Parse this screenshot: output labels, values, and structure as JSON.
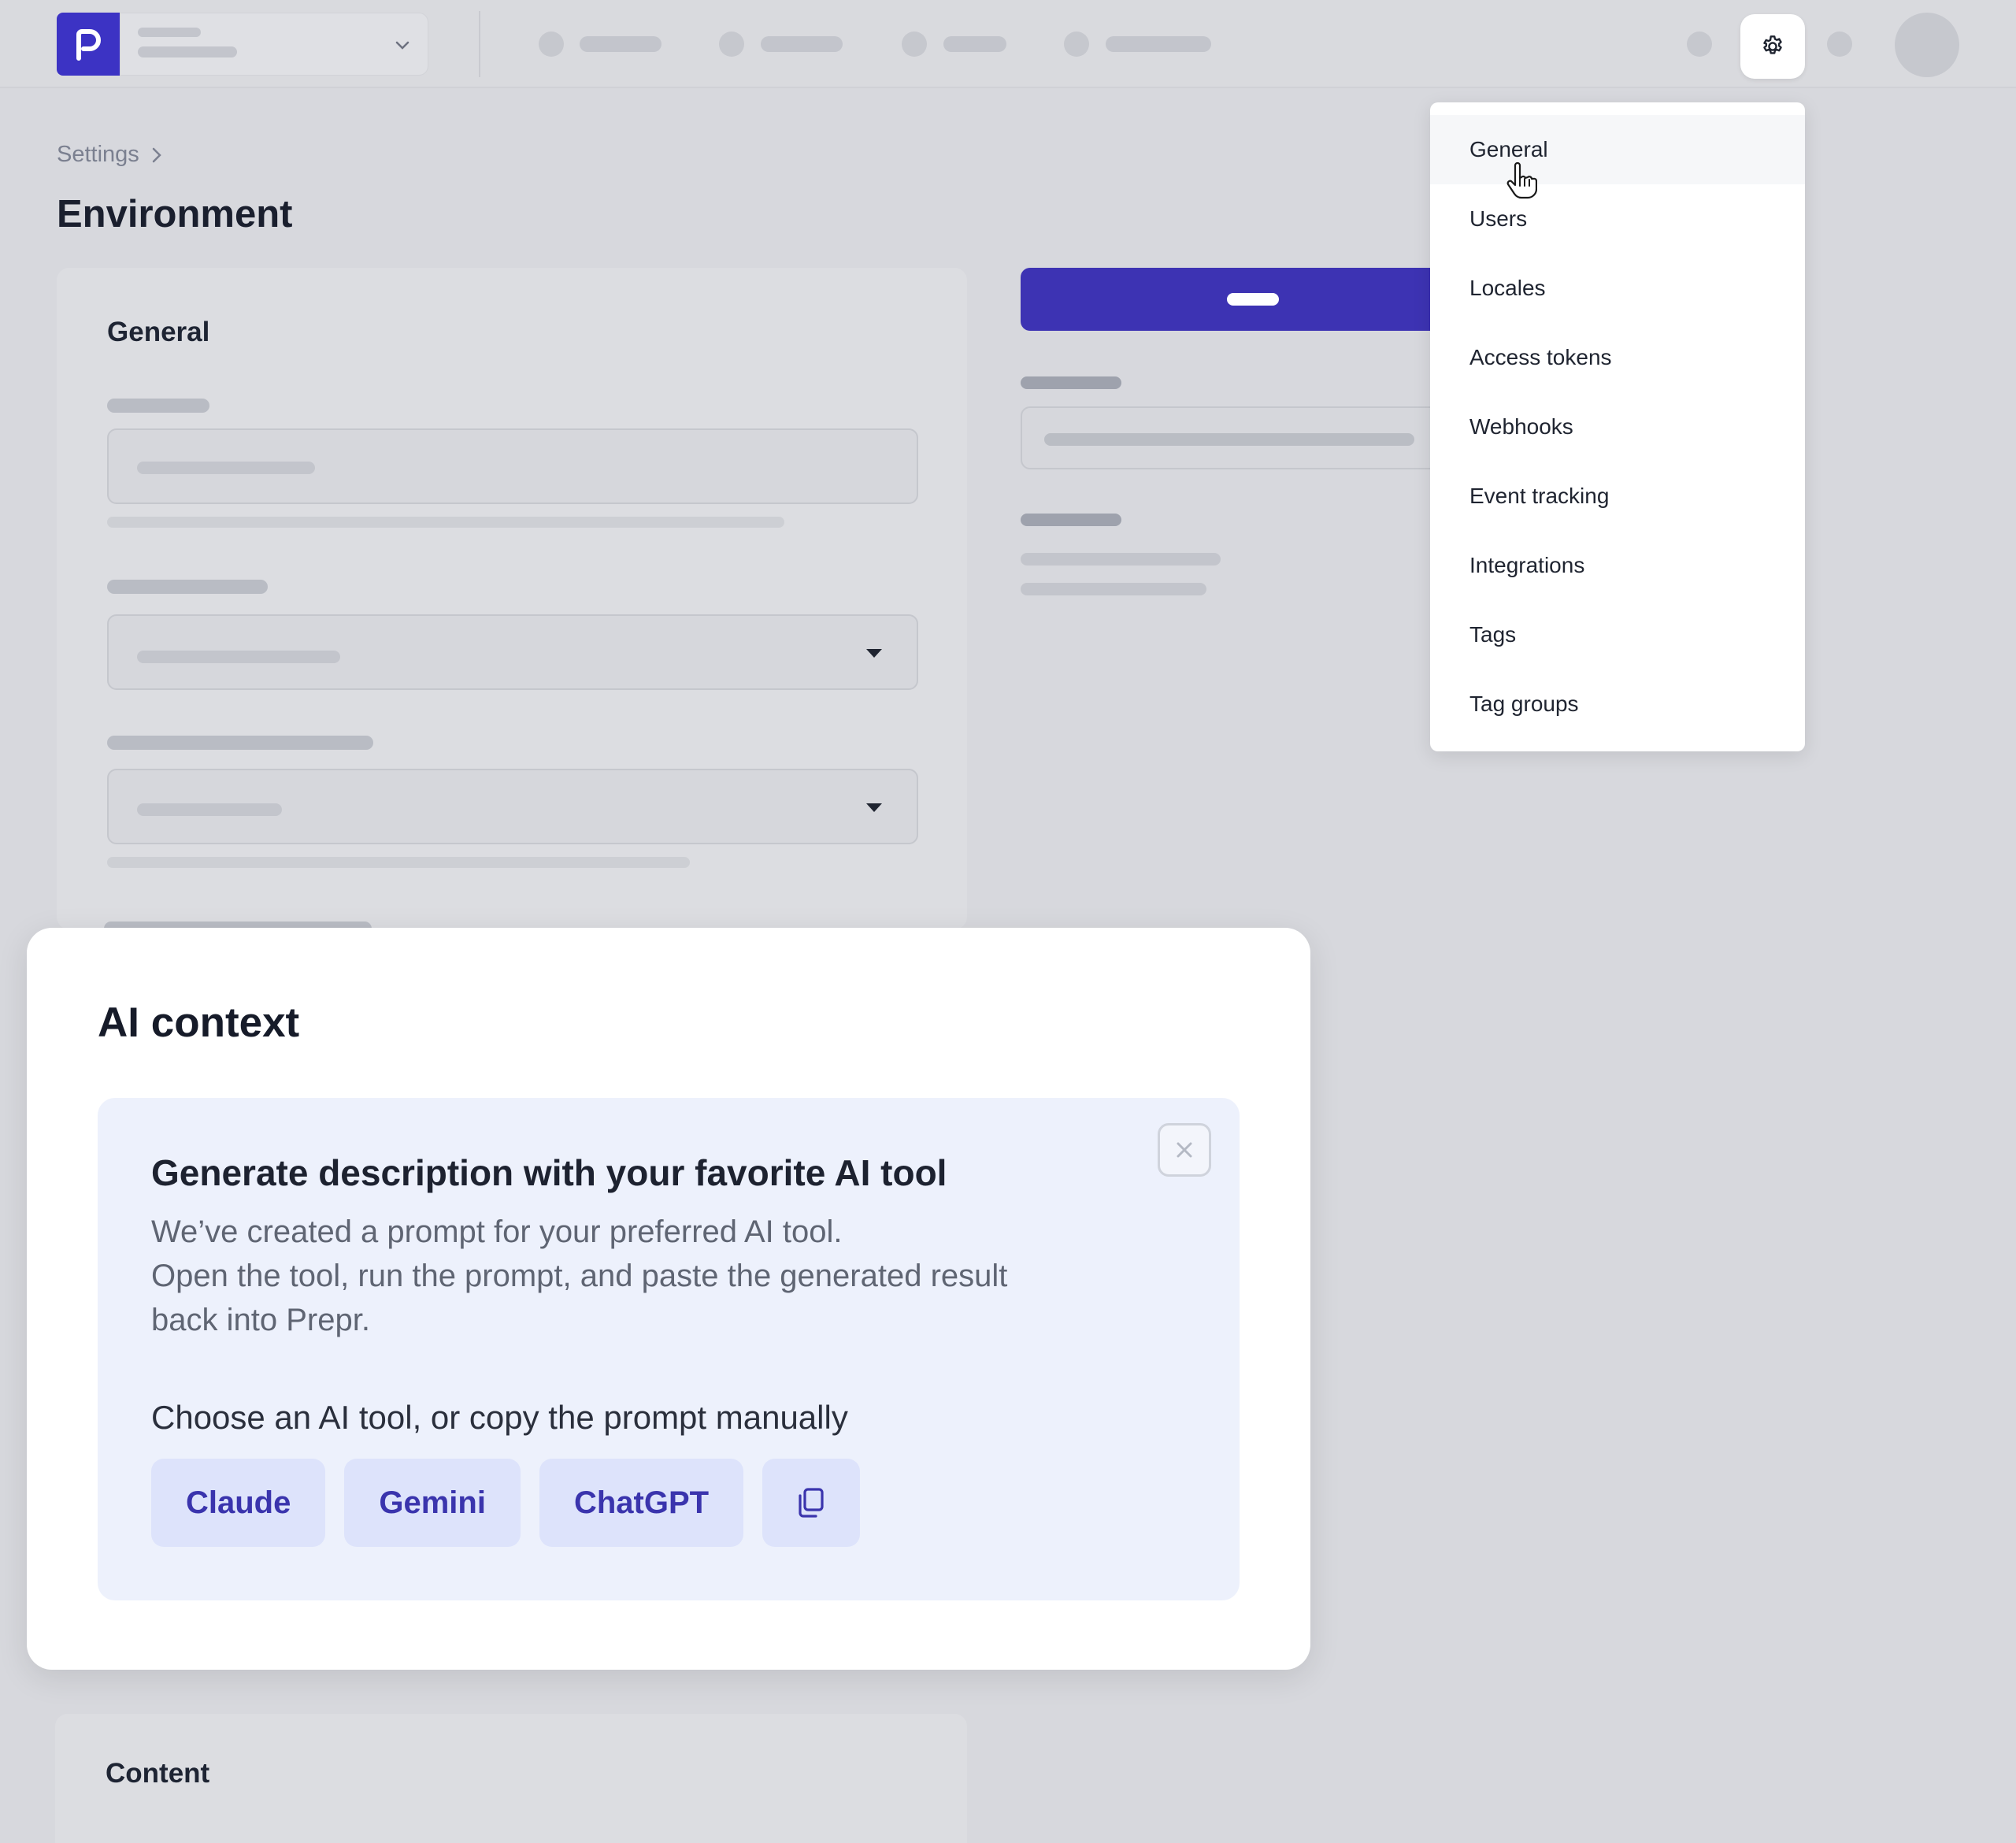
{
  "breadcrumb": {
    "label": "Settings"
  },
  "page": {
    "title": "Environment"
  },
  "general_card": {
    "title": "General"
  },
  "content_card": {
    "title": "Content"
  },
  "settings_menu": {
    "items": [
      {
        "label": "General"
      },
      {
        "label": "Users"
      },
      {
        "label": "Locales"
      },
      {
        "label": "Access tokens"
      },
      {
        "label": "Webhooks"
      },
      {
        "label": "Event tracking"
      },
      {
        "label": "Integrations"
      },
      {
        "label": "Tags"
      },
      {
        "label": "Tag groups"
      }
    ]
  },
  "modal": {
    "title": "AI context",
    "panel": {
      "title": "Generate description with your favorite AI tool",
      "line1": "We’ve created a prompt for your preferred AI tool.",
      "line2": "Open the tool, run the prompt, and paste the generated result back into Prepr.",
      "choose_label": "Choose an AI tool, or copy the prompt manually",
      "tools": [
        {
          "label": "Claude"
        },
        {
          "label": "Gemini"
        },
        {
          "label": "ChatGPT"
        }
      ]
    }
  },
  "icons": {
    "logo": "prepr-logo-icon",
    "gear": "gear-icon",
    "chevron": "chevron-down-icon",
    "close": "close-icon",
    "copy": "copy-icon",
    "cursor": "hand-pointer-icon"
  },
  "colors": {
    "brand": "#3c33c4",
    "tool_button_bg": "#dde3fb",
    "tool_button_text": "#3a34ad",
    "panel_bg": "#edf1fc"
  }
}
